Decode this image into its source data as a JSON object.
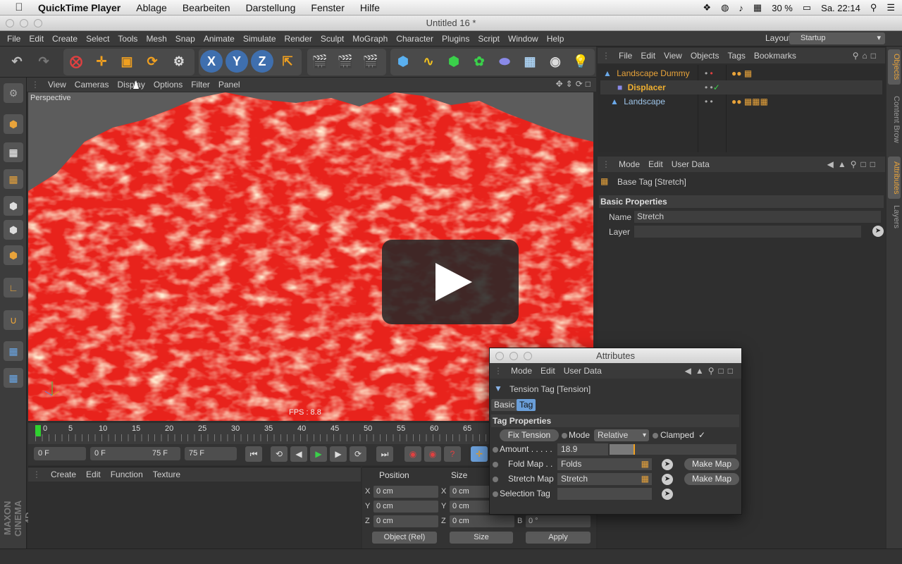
{
  "mac_menubar": {
    "app_name": "QuickTime Player",
    "items": [
      "Ablage",
      "Bearbeiten",
      "Darstellung",
      "Fenster",
      "Hilfe"
    ],
    "battery": "30 %",
    "clock": "Sa. 22:14"
  },
  "window": {
    "title": "Untitled 16 *"
  },
  "c4d_menu": {
    "items": [
      "File",
      "Edit",
      "Create",
      "Select",
      "Tools",
      "Mesh",
      "Snap",
      "Animate",
      "Simulate",
      "Render",
      "Sculpt",
      "MoGraph",
      "Character",
      "Plugins",
      "Script",
      "Window",
      "Help"
    ],
    "layout_label": "Layout:",
    "layout_value": "Startup"
  },
  "viewport": {
    "menu": [
      "View",
      "Cameras",
      "Display",
      "Options",
      "Filter",
      "Panel"
    ],
    "label": "Perspective",
    "fps": "FPS : 8.8",
    "terrain_color": "#e8231c"
  },
  "timeline": {
    "ticks": [
      "0",
      "5",
      "10",
      "15",
      "20",
      "25",
      "30",
      "35",
      "40",
      "45",
      "50",
      "55",
      "60",
      "65"
    ]
  },
  "transport": {
    "current_frame": "0 F",
    "range_start": "0 F",
    "range_end": "75 F",
    "end_frame": "75 F"
  },
  "material_manager": {
    "menu": [
      "Create",
      "Edit",
      "Function",
      "Texture"
    ]
  },
  "coordinates": {
    "position_header": "Position",
    "size_header": "Size",
    "rows": [
      {
        "axis": "X",
        "pos": "0 cm",
        "size": "0 cm"
      },
      {
        "axis": "Y",
        "pos": "0 cm",
        "size": "0 cm"
      },
      {
        "axis": "Z",
        "pos": "0 cm",
        "size": "0 cm"
      }
    ],
    "rotation_b_label": "B",
    "rotation_b": "0 °",
    "mode_select": "Object (Rel)",
    "size_select": "Size",
    "apply": "Apply"
  },
  "object_manager": {
    "menu": [
      "File",
      "Edit",
      "View",
      "Objects",
      "Tags",
      "Bookmarks"
    ],
    "objects": [
      {
        "name": "Landscape Dummy",
        "color": "#e8a33a"
      },
      {
        "name": "Displacer",
        "color": "#f0b030"
      },
      {
        "name": "Landscape",
        "color": "#9fc6ea"
      }
    ]
  },
  "attribute_manager": {
    "menu": [
      "Mode",
      "Edit",
      "User Data"
    ],
    "title": "Base Tag [Stretch]",
    "section": "Basic Properties",
    "name_label": "Name",
    "name_value": "Stretch",
    "layer_label": "Layer",
    "layer_value": ""
  },
  "side_tabs": [
    "Objects",
    "Content Brow",
    "Attributes",
    "Layers"
  ],
  "floating_window": {
    "title": "Attributes",
    "menu": [
      "Mode",
      "Edit",
      "User Data"
    ],
    "object_title": "Tension Tag [Tension]",
    "tabs": [
      "Basic",
      "Tag"
    ],
    "section": "Tag Properties",
    "fix_tension": "Fix Tension",
    "mode_label": "Mode",
    "mode_value": "Relative",
    "clamped_label": "Clamped",
    "clamped_check": "✓",
    "amount_label": "Amount . . . . .",
    "amount_value": "18.9",
    "amount_fraction": 0.189,
    "fold_map_label": "Fold Map . .",
    "fold_map_value": "Folds",
    "stretch_map_label": "Stretch Map",
    "stretch_map_value": "Stretch",
    "selection_tag_label": "Selection Tag",
    "selection_tag_value": "",
    "make_map": "Make Map"
  },
  "branding": {
    "logo_text": "MAXON CINEMA 4D"
  }
}
